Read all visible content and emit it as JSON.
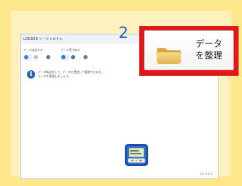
{
  "callout_number": "2",
  "highlight_color": "#e01818",
  "data_button": {
    "line1": "データ",
    "line2": "を整理",
    "icon": "folder-icon"
  },
  "app_window": {
    "title": "LOGGER ソーシャルトレ",
    "group_labels": [
      "データ送信する",
      "データ受け取る"
    ],
    "message_lines": [
      "データ転送をして、データを受信して管理できます。",
      "データを管理しましょう。"
    ],
    "device_icon": "pedometer-device-icon",
    "status_text": "Ver 1.0.0 "
  }
}
